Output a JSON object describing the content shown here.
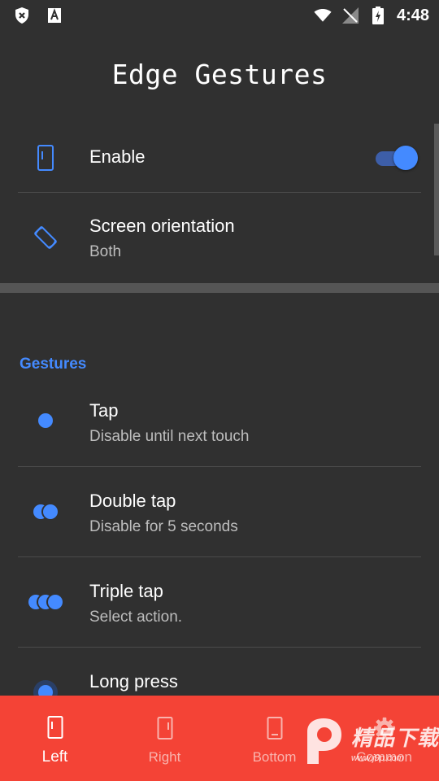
{
  "status_bar": {
    "time": "4:48",
    "left_icons": [
      "shield-x-icon",
      "font-a-icon"
    ],
    "right_icons": [
      "wifi-icon",
      "no-signal-icon",
      "battery-charging-icon"
    ]
  },
  "page": {
    "title": "Edge Gestures"
  },
  "settings": {
    "enable": {
      "label": "Enable",
      "icon": "phone-edge-icon",
      "toggle_on": true
    },
    "orientation": {
      "label": "Screen orientation",
      "value": "Both",
      "icon": "screen-rotation-icon"
    }
  },
  "gestures": {
    "header": "Gestures",
    "items": [
      {
        "label": "Tap",
        "action": "Disable until next touch",
        "icon": "single-dot-icon"
      },
      {
        "label": "Double tap",
        "action": "Disable for 5 seconds",
        "icon": "double-dot-icon"
      },
      {
        "label": "Triple tap",
        "action": "Select action.",
        "icon": "triple-dot-icon"
      },
      {
        "label": "Long press",
        "action": "",
        "icon": "long-press-dot-icon"
      }
    ]
  },
  "bottom_nav": {
    "items": [
      {
        "label": "Left",
        "icon": "phone-left-edge-icon",
        "active": true
      },
      {
        "label": "Right",
        "icon": "phone-right-edge-icon",
        "active": false
      },
      {
        "label": "Bottom",
        "icon": "phone-bottom-edge-icon",
        "active": false
      },
      {
        "label": "Common",
        "icon": "gear-icon",
        "active": false
      }
    ]
  },
  "watermark": {
    "title": "精品下载",
    "url": "www.j9p.com"
  },
  "colors": {
    "accent": "#448aff",
    "background": "#303030",
    "bottom_nav": "#f44336",
    "secondary_text": "#bdbdbd"
  }
}
